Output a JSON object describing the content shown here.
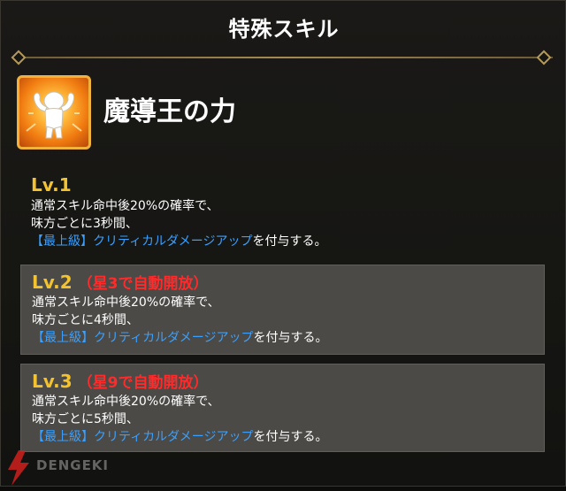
{
  "header": {
    "title": "特殊スキル"
  },
  "skill": {
    "name": "魔導王の力",
    "icon": "flexing-hero-icon",
    "icon_colors": {
      "border": "#f0b23a",
      "glow": "#ffb83a"
    }
  },
  "levels": [
    {
      "label": "Lv.1",
      "condition": "",
      "line1": "通常スキル命中後20%の確率で、",
      "line2": "味方ごとに3秒間、",
      "tag": "【最上級】",
      "effect": "クリティカルダメージアップ",
      "suffix": "を付与する。"
    },
    {
      "label": "Lv.2",
      "condition": "（星3で自動開放）",
      "line1": "通常スキル命中後20%の確率で、",
      "line2": "味方ごとに4秒間、",
      "tag": "【最上級】",
      "effect": "クリティカルダメージアップ",
      "suffix": "を付与する。"
    },
    {
      "label": "Lv.3",
      "condition": "（星9で自動開放）",
      "line1": "通常スキル命中後20%の確率で、",
      "line2": "味方ごとに5秒間、",
      "tag": "【最上級】",
      "effect": "クリティカルダメージアップ",
      "suffix": "を付与する。"
    }
  ],
  "watermark": {
    "text": "DENGEKI"
  },
  "colors": {
    "level_label": "#f2c230",
    "condition": "#ff2a2a",
    "keyword": "#3aa0ff",
    "locked_bg": "#4b4a47"
  }
}
